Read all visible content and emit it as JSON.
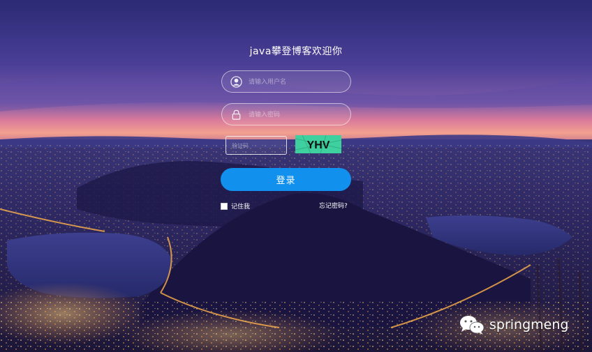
{
  "page": {
    "title": "java攀登博客欢迎你"
  },
  "login_form": {
    "username_placeholder": "请输入用户名",
    "password_placeholder": "请输入密码",
    "captcha_placeholder": "验证码",
    "captcha_text": "YHV",
    "login_label": "登录",
    "remember_label": "记住我",
    "forgot_label": "忘记密码?"
  },
  "watermark": {
    "text": "springmeng"
  },
  "icons": {
    "username": "user-icon",
    "password": "lock-icon",
    "watermark_logo": "wechat-icon"
  },
  "colors": {
    "primary_button": "#1190ee",
    "captcha_bg": "#3fd0a0",
    "captcha_text": "#111111"
  }
}
